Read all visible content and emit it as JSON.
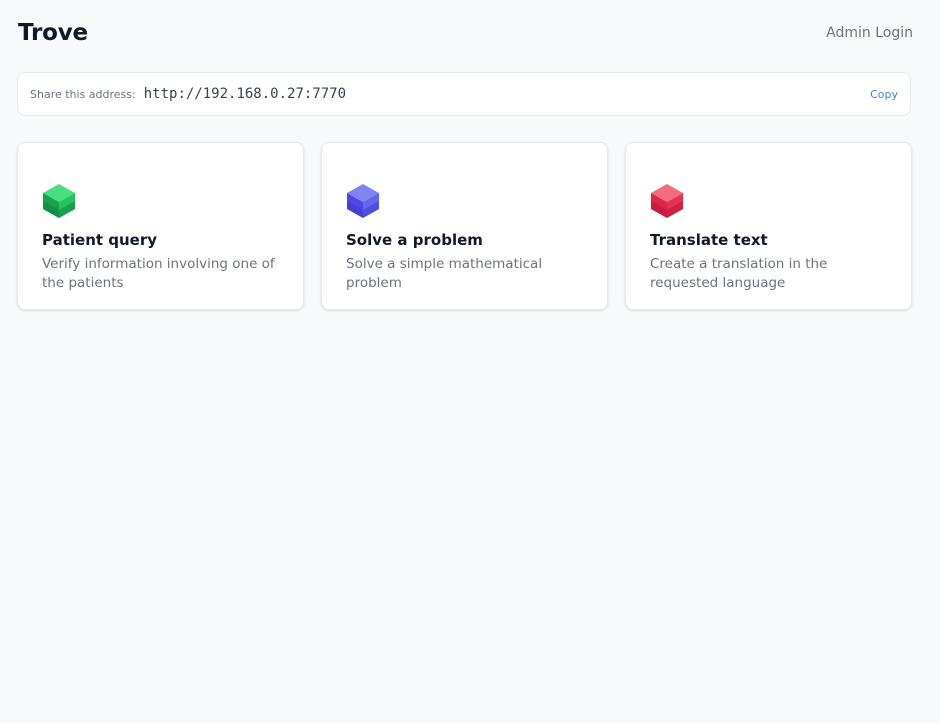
{
  "app": {
    "title": "Trove",
    "admin_link": "Admin Login"
  },
  "share": {
    "label": "Share this address:",
    "address": "http://192.168.0.27:7770",
    "copy_label": "Copy"
  },
  "cards": [
    {
      "title": "Patient query",
      "description": "Verify information involving one of the patients",
      "icon": "green-cube-icon",
      "color": "#22c55e"
    },
    {
      "title": "Solve a problem",
      "description": "Solve a simple mathematical problem",
      "icon": "blue-cube-icon",
      "color": "#5b5ce6"
    },
    {
      "title": "Translate text",
      "description": "Create a translation in the requested language",
      "icon": "red-cube-icon",
      "color": "#e5334f"
    }
  ],
  "colors": {
    "background": "#f8f9fb",
    "accent": "#3b82f6",
    "text": "#111827",
    "muted": "#6b7280"
  }
}
